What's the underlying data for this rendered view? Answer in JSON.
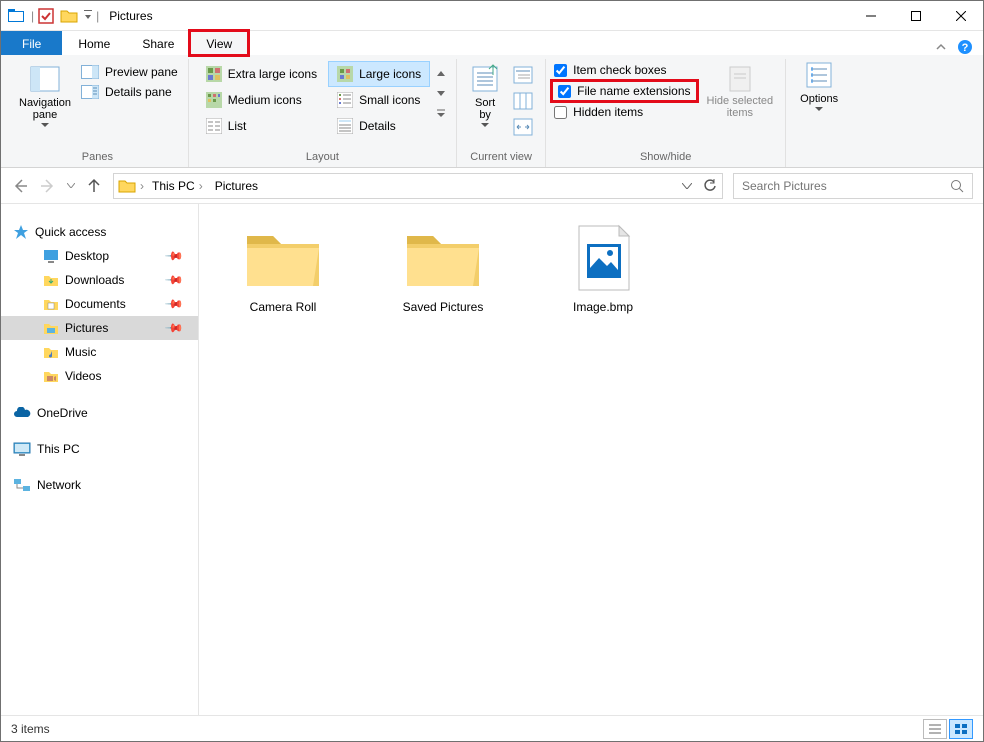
{
  "title": "Pictures",
  "tabs": {
    "file": "File",
    "home": "Home",
    "share": "Share",
    "view": "View"
  },
  "ribbon": {
    "panes": {
      "nav": "Navigation\npane",
      "preview": "Preview pane",
      "details": "Details pane",
      "label": "Panes"
    },
    "layout": {
      "items": [
        "Extra large icons",
        "Large icons",
        "Medium icons",
        "Small icons",
        "List",
        "Details"
      ],
      "label": "Layout"
    },
    "currentview": {
      "sortby": "Sort\nby",
      "label": "Current view"
    },
    "showhide": {
      "itemcheck": "Item check boxes",
      "fileext": "File name extensions",
      "hidden": "Hidden items",
      "hidesel": "Hide selected\nitems",
      "label": "Show/hide"
    },
    "options": "Options"
  },
  "breadcrumb": {
    "thispc": "This PC",
    "pictures": "Pictures"
  },
  "search": {
    "placeholder": "Search Pictures"
  },
  "sidebar": {
    "quick": "Quick access",
    "items": [
      "Desktop",
      "Downloads",
      "Documents",
      "Pictures",
      "Music",
      "Videos"
    ],
    "onedrive": "OneDrive",
    "thispc": "This PC",
    "network": "Network"
  },
  "files": {
    "cameraroll": "Camera Roll",
    "savedpics": "Saved Pictures",
    "image": "Image.bmp"
  },
  "status": "3 items"
}
